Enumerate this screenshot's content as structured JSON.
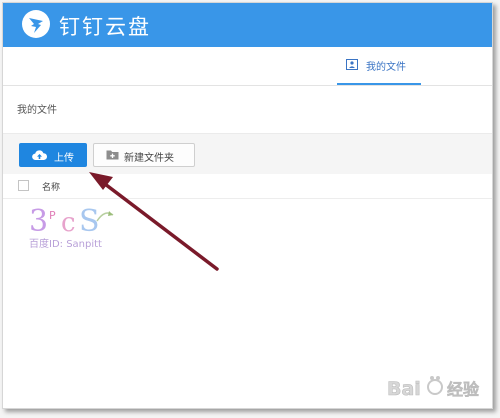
{
  "header": {
    "app_title": "钉钉云盘",
    "logo_icon": "dingtalk-logo-icon",
    "background_color": "#3996e8"
  },
  "tabs": [
    {
      "label": "我的文件",
      "icon": "user-folder-icon",
      "active": true
    }
  ],
  "breadcrumb": "我的文件",
  "toolbar": {
    "upload_label": "上传",
    "upload_icon": "cloud-upload-icon",
    "new_folder_label": "新建文件夹",
    "new_folder_icon": "folder-plus-icon",
    "accent_color": "#1f86e0"
  },
  "file_list": {
    "columns": [
      "名称"
    ]
  },
  "annotation": {
    "arrow_color": "#7a1a2a"
  },
  "watermarks": {
    "author_logo": "3PCS",
    "author_text": "百度ID: Sanpitt",
    "corner_logo": "Bai 经验"
  }
}
